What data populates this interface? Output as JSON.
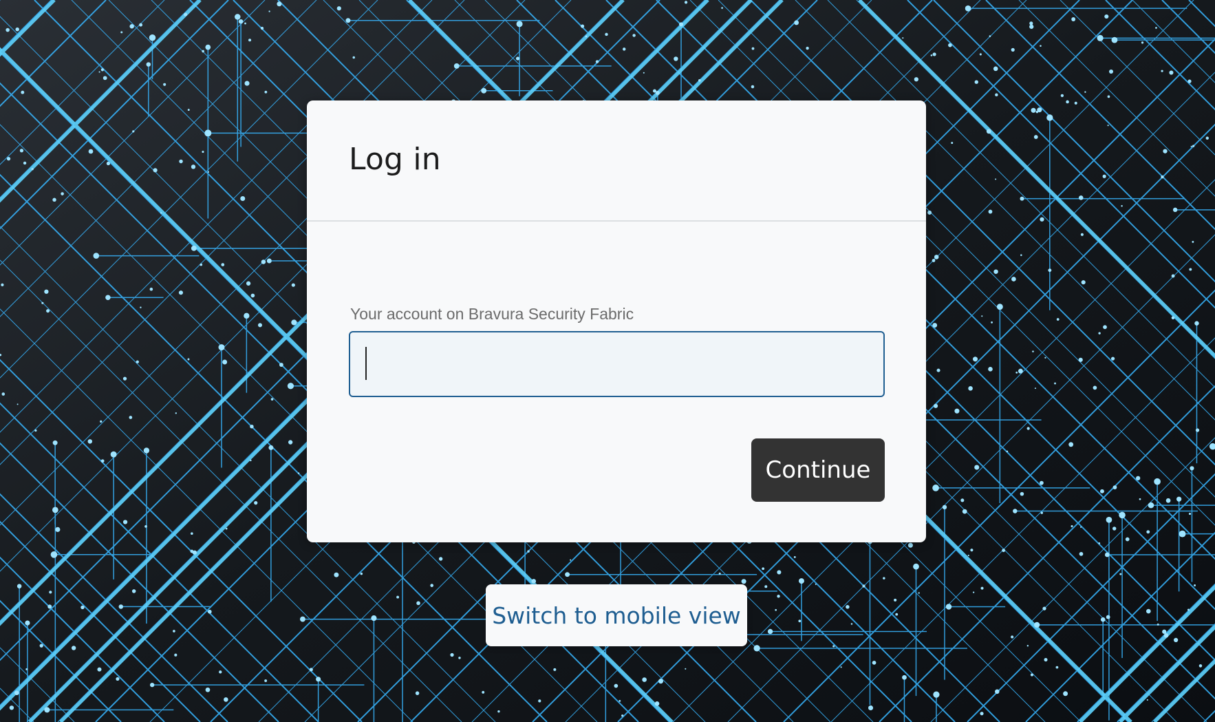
{
  "page": {
    "background_icon": "circuit-board-background"
  },
  "login": {
    "title": "Log in",
    "account_label": "Your account on Bravura Security Fabric",
    "account_value": "",
    "account_placeholder": "",
    "continue_label": "Continue"
  },
  "footer": {
    "mobile_view_label": "Switch to mobile view"
  },
  "colors": {
    "accent": "#1f5e91",
    "button_dark": "#333333",
    "card_bg": "#f8f9fa",
    "circuit_line": "#38b6ff"
  }
}
